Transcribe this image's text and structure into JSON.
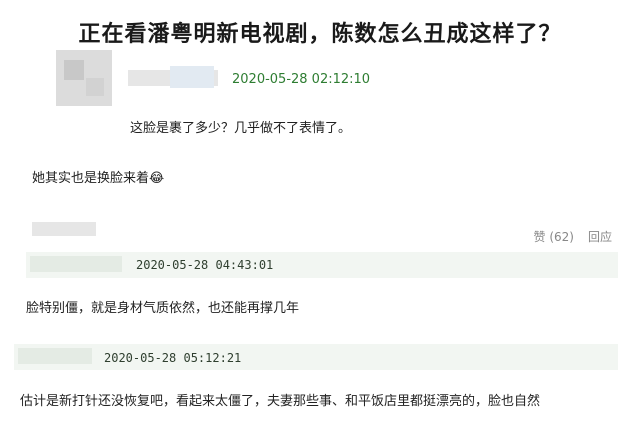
{
  "title": "正在看潘粤明新电视剧，陈数怎么丑成这样了？",
  "comment1": {
    "timestamp": "2020-05-28 02:12:10",
    "text": "这脸是裹了多少？几乎做不了表情了。"
  },
  "comment2": {
    "text": "她其实也是换脸来着",
    "emoji": "😂",
    "likes_label": "赞 (62)",
    "reply_label": "回应"
  },
  "reply1": {
    "timestamp": "2020-05-28 04:43:01",
    "text": "脸特别僵，就是身材气质依然，也还能再撑几年"
  },
  "reply2": {
    "timestamp": "2020-05-28 05:12:21",
    "text": "估计是新打针还没恢复吧，看起来太僵了，夫妻那些事、和平饭店里都挺漂亮的，脸也自然"
  },
  "colors": {
    "timestamp_green": "#2e7d32",
    "reply_bar": "#f2f6f2"
  }
}
